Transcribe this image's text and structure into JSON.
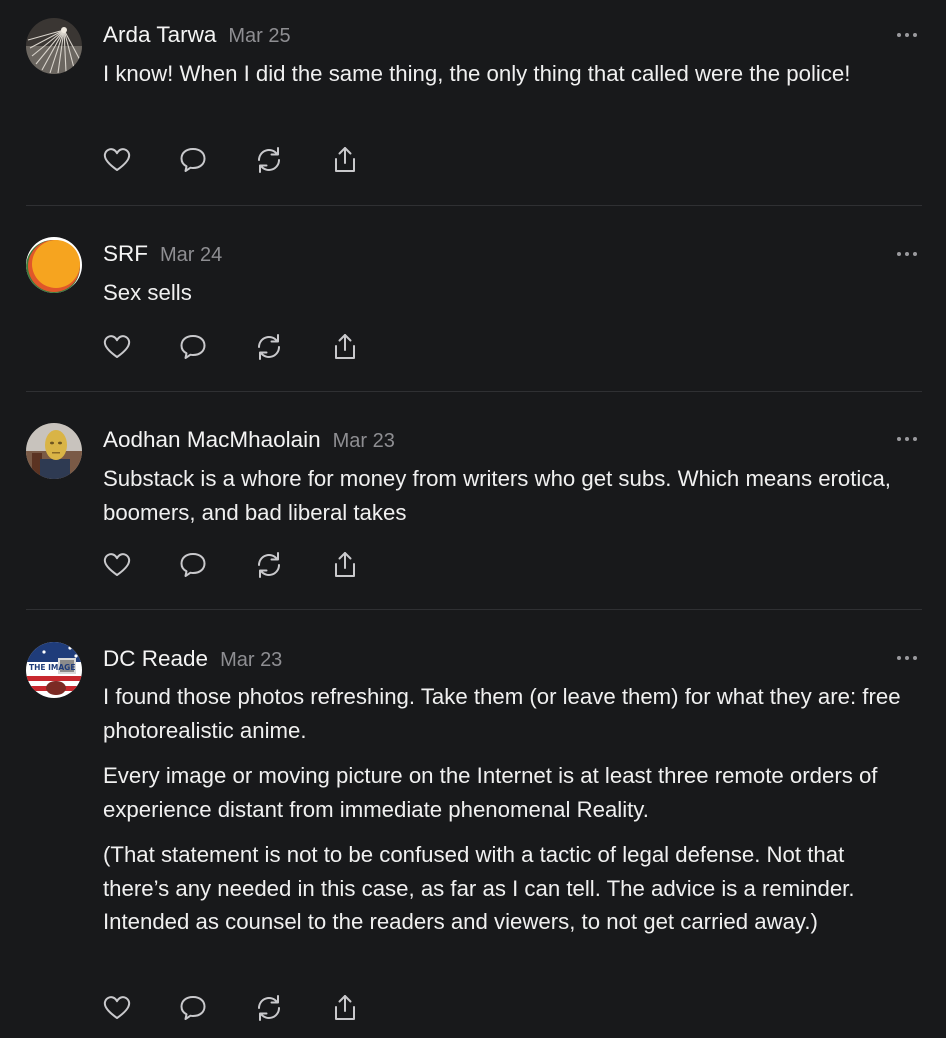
{
  "comments": [
    {
      "author": "Arda Tarwa",
      "date": "Mar 25",
      "avatar_icon": "fan-feathers-avatar",
      "paragraphs": [
        "I know! When I did the same thing, the only thing that called were the police!"
      ]
    },
    {
      "author": "SRF",
      "date": "Mar 24",
      "avatar_icon": "orange-circle-avatar",
      "paragraphs": [
        "Sex sells"
      ]
    },
    {
      "author": "Aodhan MacMhaolain",
      "date": "Mar 23",
      "avatar_icon": "gold-mask-avatar",
      "paragraphs": [
        "Substack is a whore for money from writers who get subs. Which means erotica, boomers, and bad liberal takes"
      ]
    },
    {
      "author": "DC Reade",
      "date": "Mar 23",
      "avatar_icon": "the-image-badge-avatar",
      "avatar_text": "THE IMAGE",
      "paragraphs": [
        "I found those photos refreshing. Take them (or leave them) for what they are: free photorealistic anime.",
        "Every image or moving picture on the Internet is at least three remote orders of experience distant from immediate phenomenal Reality.",
        "(That statement is not to be confused with a tactic of legal defense. Not that there’s any needed in this case, as far as I can tell. The advice is a reminder. Intended as counsel to the readers and viewers, to not get carried away.)"
      ]
    }
  ],
  "action_icons": [
    "heart-icon",
    "reply-icon",
    "restack-icon",
    "share-icon"
  ],
  "colors": {
    "background": "#18191b",
    "text": "#f2f2f2",
    "muted": "#8e8e92",
    "divider": "#2f3033",
    "icon": "#c9c9cc"
  }
}
